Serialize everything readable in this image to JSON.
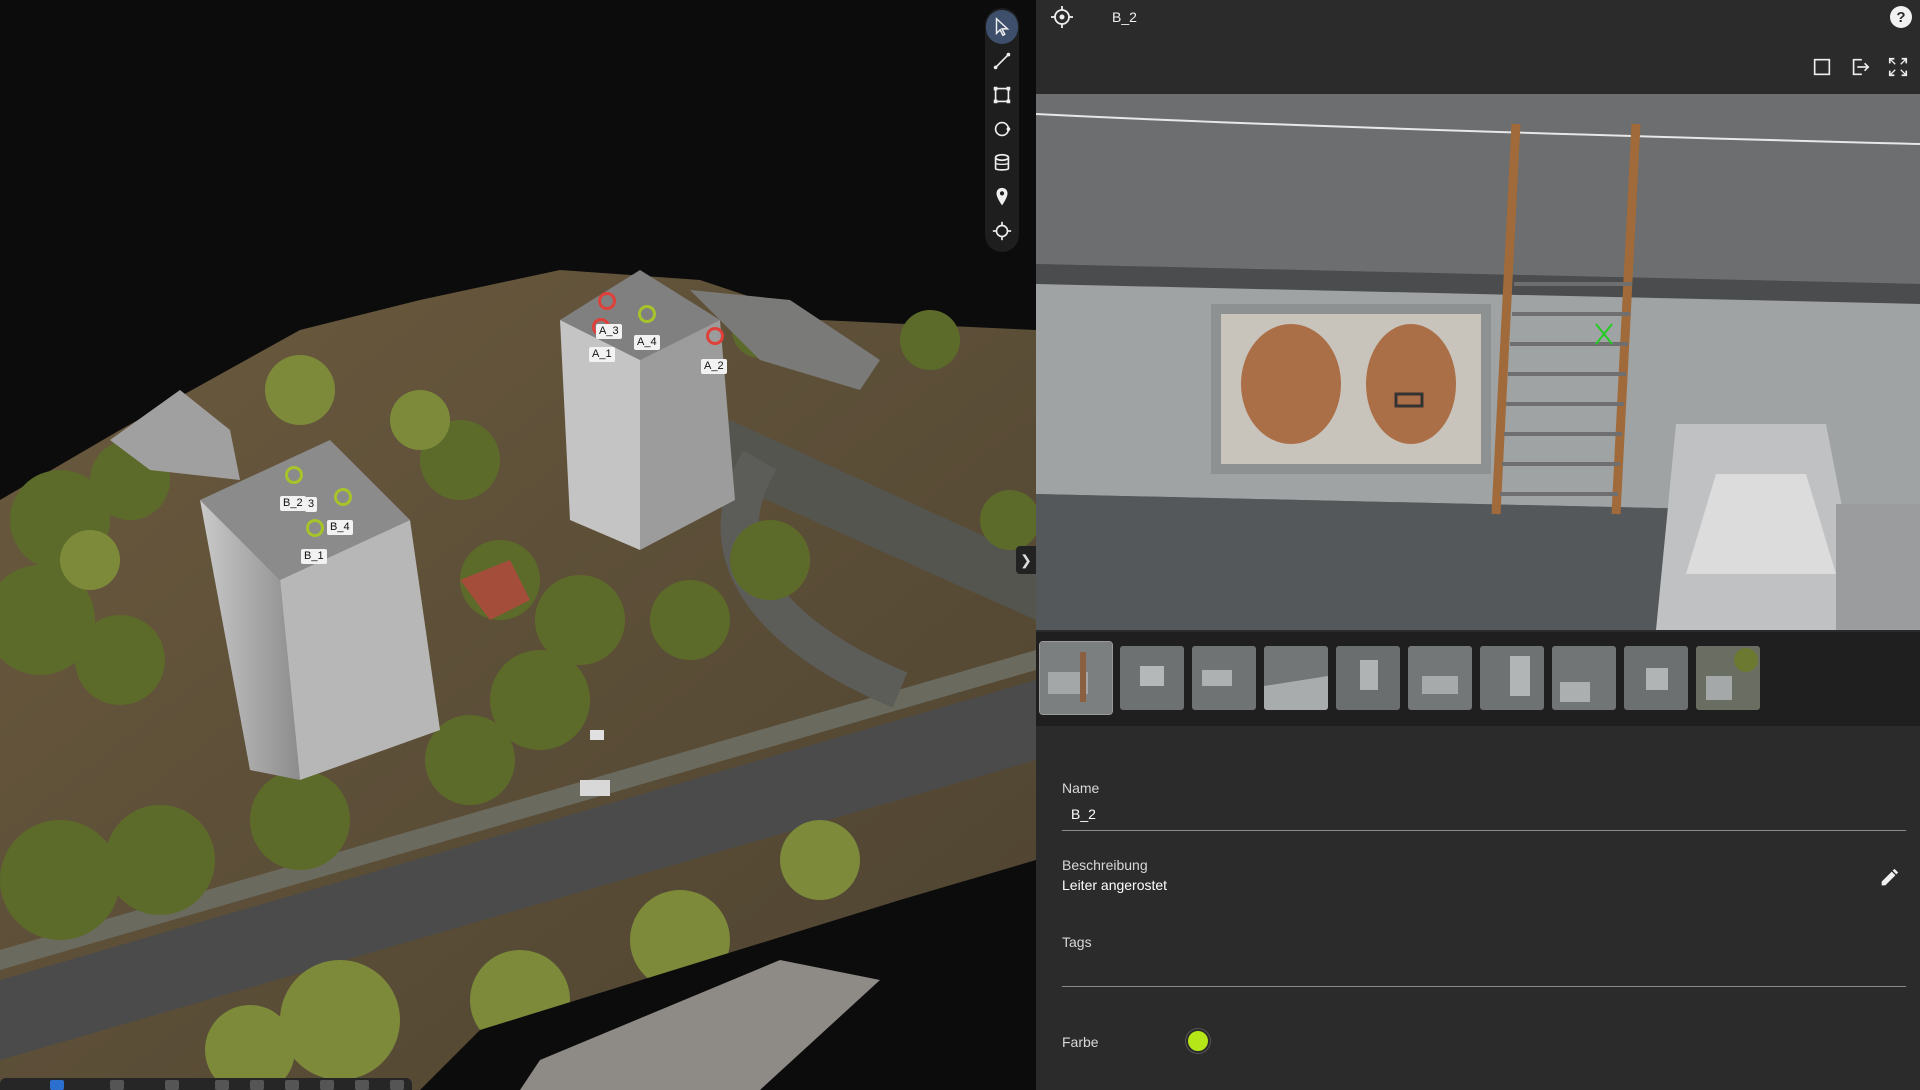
{
  "viewer": {
    "markers": {
      "b_group": [
        "B_2",
        "3",
        "B_4",
        "B_1"
      ],
      "a_group": [
        "A_3",
        "A_4",
        "A_1",
        "A_2"
      ]
    },
    "toolbar": [
      "select-tool",
      "measure-line-tool",
      "area-tool",
      "circle-tool",
      "volume-tool",
      "place-marker-tool",
      "point-tool"
    ]
  },
  "panel": {
    "header": {
      "title": "B_2",
      "help": "?"
    },
    "photo_toolbar": [
      "frame-icon",
      "export-icon",
      "fullscreen-icon"
    ],
    "thumbnails_count": 10,
    "selected_thumbnail": 1,
    "form": {
      "name_label": "Name",
      "name_value": "B_2",
      "description_label": "Beschreibung",
      "description_value": "Leiter angerostet",
      "tags_label": "Tags",
      "color_label": "Farbe",
      "color_value": "#b5e617"
    }
  },
  "colors": {
    "accent": "#3d4f6a",
    "panel_bg": "#2b2b2b",
    "marker_red": "#e0403a",
    "marker_green": "#a6c42a"
  }
}
